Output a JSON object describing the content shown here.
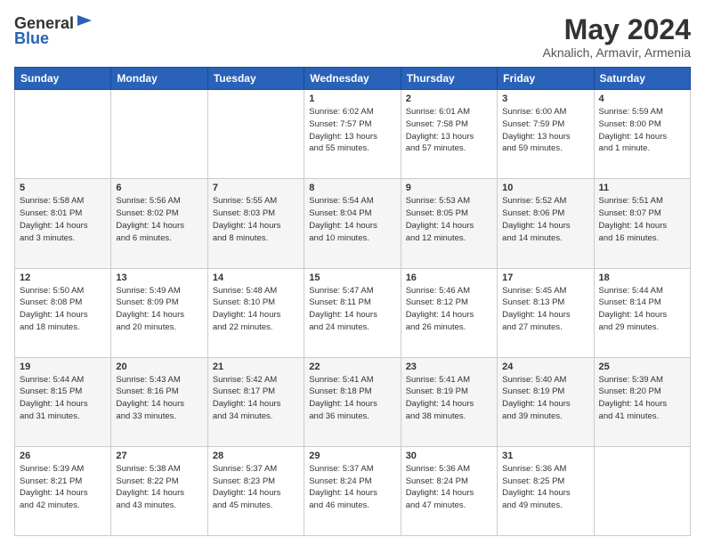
{
  "header": {
    "logo_line1": "General",
    "logo_line2": "Blue",
    "title": "May 2024",
    "subtitle": "Aknalich, Armavir, Armenia"
  },
  "calendar": {
    "headers": [
      "Sunday",
      "Monday",
      "Tuesday",
      "Wednesday",
      "Thursday",
      "Friday",
      "Saturday"
    ],
    "weeks": [
      [
        {
          "day": "",
          "info": ""
        },
        {
          "day": "",
          "info": ""
        },
        {
          "day": "",
          "info": ""
        },
        {
          "day": "1",
          "info": "Sunrise: 6:02 AM\nSunset: 7:57 PM\nDaylight: 13 hours\nand 55 minutes."
        },
        {
          "day": "2",
          "info": "Sunrise: 6:01 AM\nSunset: 7:58 PM\nDaylight: 13 hours\nand 57 minutes."
        },
        {
          "day": "3",
          "info": "Sunrise: 6:00 AM\nSunset: 7:59 PM\nDaylight: 13 hours\nand 59 minutes."
        },
        {
          "day": "4",
          "info": "Sunrise: 5:59 AM\nSunset: 8:00 PM\nDaylight: 14 hours\nand 1 minute."
        }
      ],
      [
        {
          "day": "5",
          "info": "Sunrise: 5:58 AM\nSunset: 8:01 PM\nDaylight: 14 hours\nand 3 minutes."
        },
        {
          "day": "6",
          "info": "Sunrise: 5:56 AM\nSunset: 8:02 PM\nDaylight: 14 hours\nand 6 minutes."
        },
        {
          "day": "7",
          "info": "Sunrise: 5:55 AM\nSunset: 8:03 PM\nDaylight: 14 hours\nand 8 minutes."
        },
        {
          "day": "8",
          "info": "Sunrise: 5:54 AM\nSunset: 8:04 PM\nDaylight: 14 hours\nand 10 minutes."
        },
        {
          "day": "9",
          "info": "Sunrise: 5:53 AM\nSunset: 8:05 PM\nDaylight: 14 hours\nand 12 minutes."
        },
        {
          "day": "10",
          "info": "Sunrise: 5:52 AM\nSunset: 8:06 PM\nDaylight: 14 hours\nand 14 minutes."
        },
        {
          "day": "11",
          "info": "Sunrise: 5:51 AM\nSunset: 8:07 PM\nDaylight: 14 hours\nand 16 minutes."
        }
      ],
      [
        {
          "day": "12",
          "info": "Sunrise: 5:50 AM\nSunset: 8:08 PM\nDaylight: 14 hours\nand 18 minutes."
        },
        {
          "day": "13",
          "info": "Sunrise: 5:49 AM\nSunset: 8:09 PM\nDaylight: 14 hours\nand 20 minutes."
        },
        {
          "day": "14",
          "info": "Sunrise: 5:48 AM\nSunset: 8:10 PM\nDaylight: 14 hours\nand 22 minutes."
        },
        {
          "day": "15",
          "info": "Sunrise: 5:47 AM\nSunset: 8:11 PM\nDaylight: 14 hours\nand 24 minutes."
        },
        {
          "day": "16",
          "info": "Sunrise: 5:46 AM\nSunset: 8:12 PM\nDaylight: 14 hours\nand 26 minutes."
        },
        {
          "day": "17",
          "info": "Sunrise: 5:45 AM\nSunset: 8:13 PM\nDaylight: 14 hours\nand 27 minutes."
        },
        {
          "day": "18",
          "info": "Sunrise: 5:44 AM\nSunset: 8:14 PM\nDaylight: 14 hours\nand 29 minutes."
        }
      ],
      [
        {
          "day": "19",
          "info": "Sunrise: 5:44 AM\nSunset: 8:15 PM\nDaylight: 14 hours\nand 31 minutes."
        },
        {
          "day": "20",
          "info": "Sunrise: 5:43 AM\nSunset: 8:16 PM\nDaylight: 14 hours\nand 33 minutes."
        },
        {
          "day": "21",
          "info": "Sunrise: 5:42 AM\nSunset: 8:17 PM\nDaylight: 14 hours\nand 34 minutes."
        },
        {
          "day": "22",
          "info": "Sunrise: 5:41 AM\nSunset: 8:18 PM\nDaylight: 14 hours\nand 36 minutes."
        },
        {
          "day": "23",
          "info": "Sunrise: 5:41 AM\nSunset: 8:19 PM\nDaylight: 14 hours\nand 38 minutes."
        },
        {
          "day": "24",
          "info": "Sunrise: 5:40 AM\nSunset: 8:19 PM\nDaylight: 14 hours\nand 39 minutes."
        },
        {
          "day": "25",
          "info": "Sunrise: 5:39 AM\nSunset: 8:20 PM\nDaylight: 14 hours\nand 41 minutes."
        }
      ],
      [
        {
          "day": "26",
          "info": "Sunrise: 5:39 AM\nSunset: 8:21 PM\nDaylight: 14 hours\nand 42 minutes."
        },
        {
          "day": "27",
          "info": "Sunrise: 5:38 AM\nSunset: 8:22 PM\nDaylight: 14 hours\nand 43 minutes."
        },
        {
          "day": "28",
          "info": "Sunrise: 5:37 AM\nSunset: 8:23 PM\nDaylight: 14 hours\nand 45 minutes."
        },
        {
          "day": "29",
          "info": "Sunrise: 5:37 AM\nSunset: 8:24 PM\nDaylight: 14 hours\nand 46 minutes."
        },
        {
          "day": "30",
          "info": "Sunrise: 5:36 AM\nSunset: 8:24 PM\nDaylight: 14 hours\nand 47 minutes."
        },
        {
          "day": "31",
          "info": "Sunrise: 5:36 AM\nSunset: 8:25 PM\nDaylight: 14 hours\nand 49 minutes."
        },
        {
          "day": "",
          "info": ""
        }
      ]
    ]
  }
}
